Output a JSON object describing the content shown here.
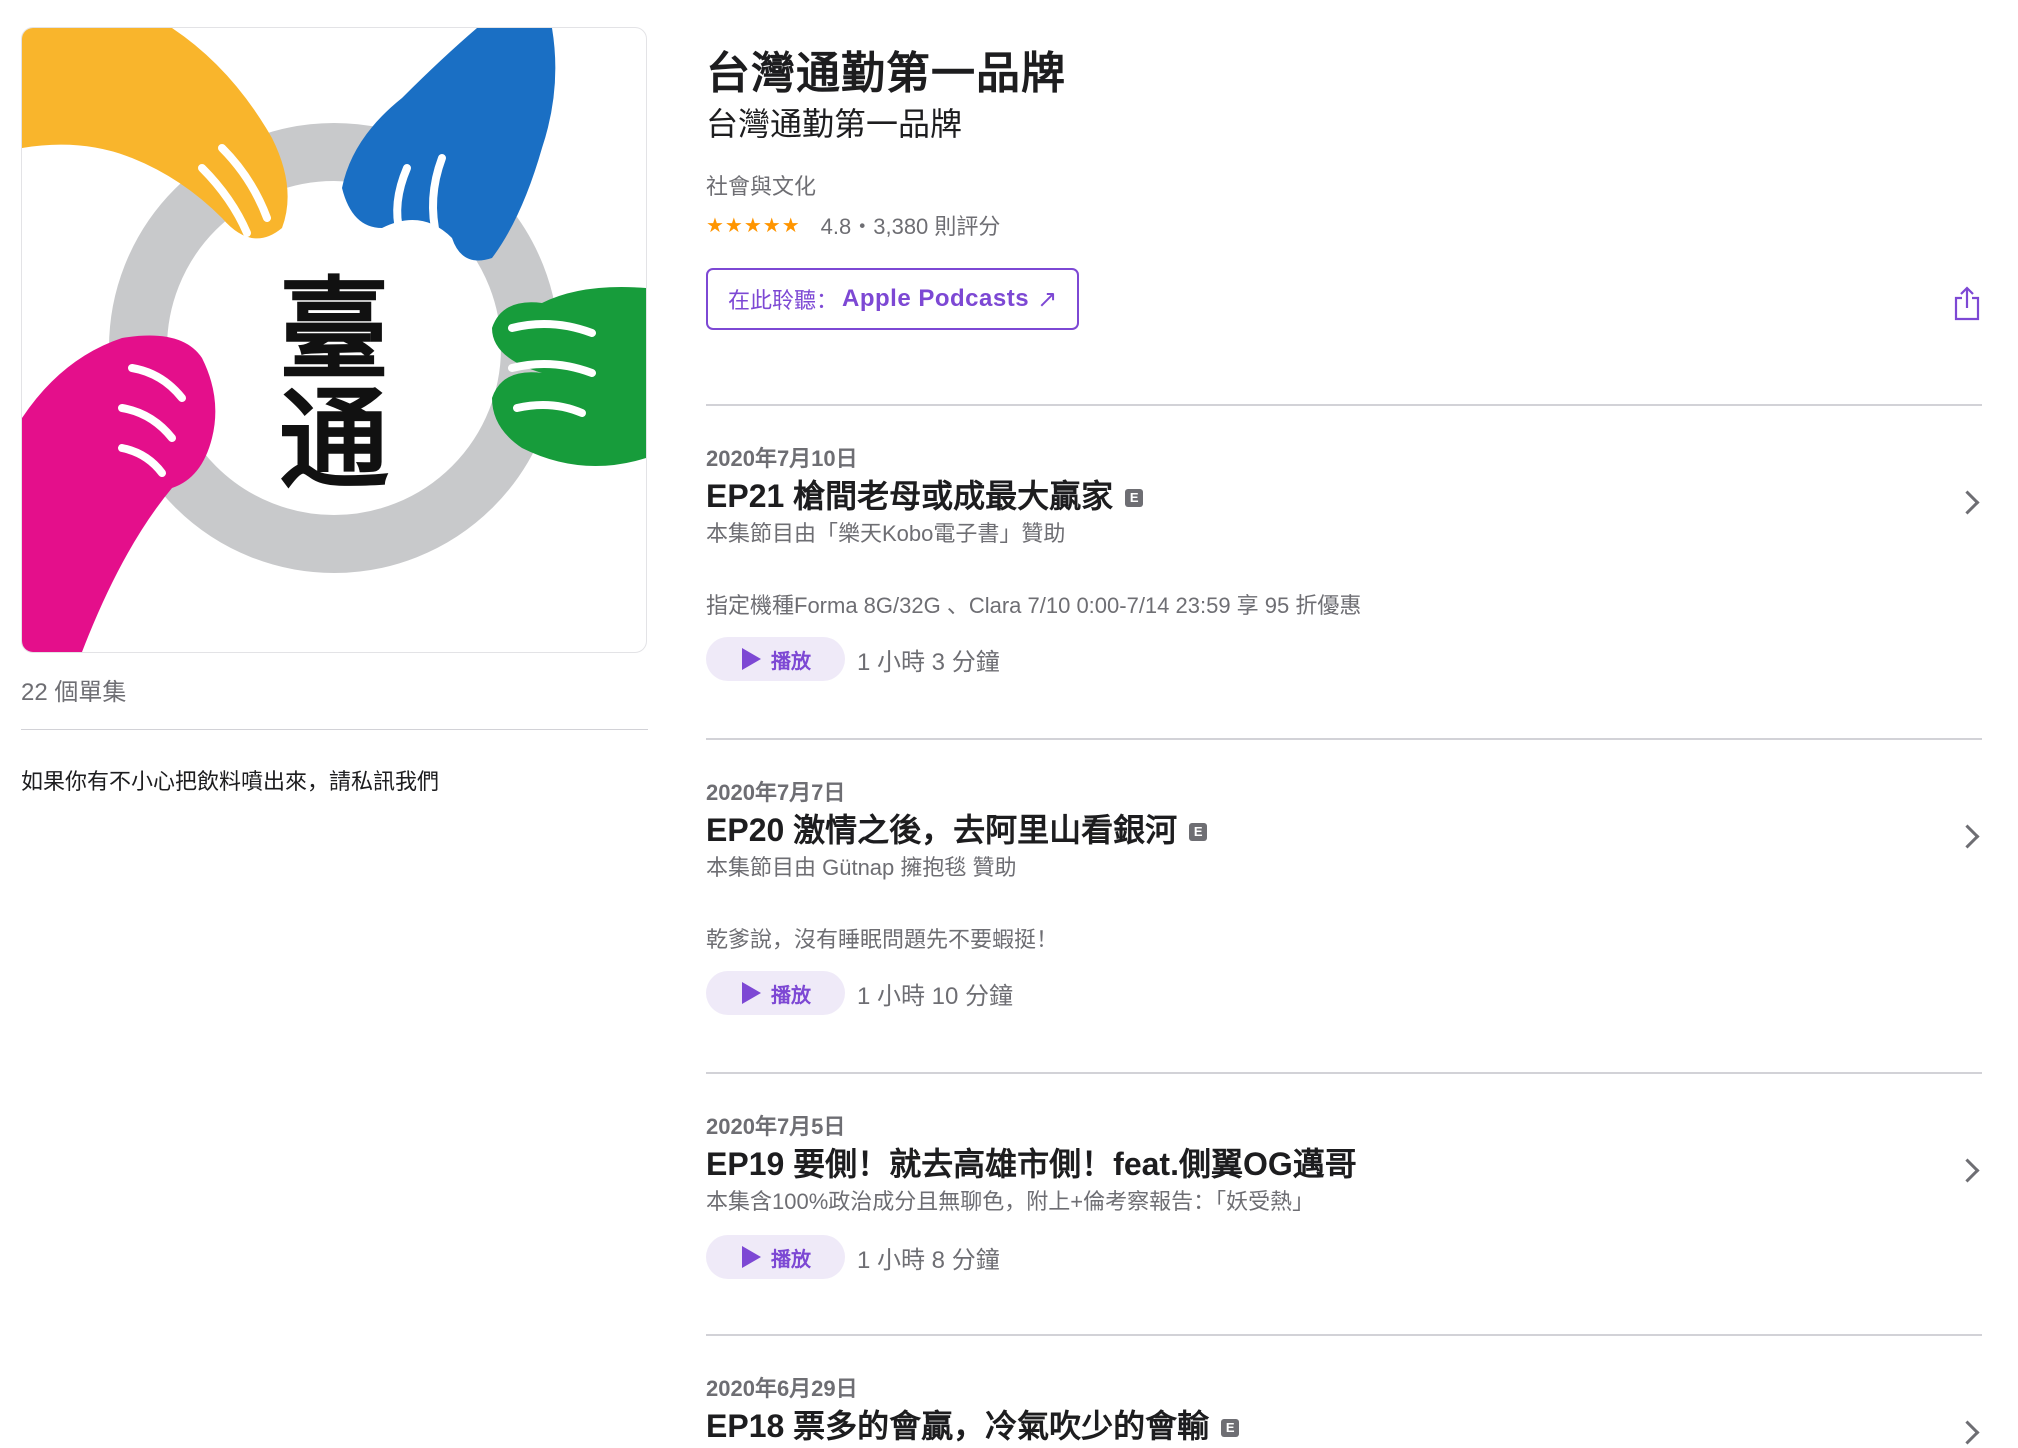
{
  "show": {
    "title": "台灣通勤第一品牌",
    "author": "台灣通勤第一品牌",
    "category": "社會與文化",
    "stars": "★★★★★",
    "rating": "4.8・3,380 則評分",
    "listen_prefix": "在此聆聽：",
    "listen_brand": "Apple Podcasts",
    "listen_arrow": "↗",
    "artwork_text_top": "臺",
    "artwork_text_bottom": "通",
    "episode_count": "22 個單集",
    "description": "如果你有不小心把飲料噴出來，請私訊我們"
  },
  "colors": {
    "accent": "#7d48d4",
    "star": "#ff9500",
    "hand_yellow": "#f9b52c",
    "hand_blue": "#1a6fc4",
    "hand_green": "#179c3b",
    "hand_pink": "#e40f8b",
    "ring_gray": "#c8c9cb"
  },
  "episodes": [
    {
      "date": "2020年7月10日",
      "title": "EP21 槍間老母或成最大贏家",
      "explicit": "E",
      "subtitle": "本集節目由「樂天Kobo電子書」贊助",
      "extra": "指定機種Forma 8G/32G 、Clara 7/10 0:00-7/14 23:59  享 95 折優惠",
      "play": "播放",
      "duration": "1 小時 3 分鐘"
    },
    {
      "date": "2020年7月7日",
      "title": "EP20 激情之後，去阿里山看銀河",
      "explicit": "E",
      "subtitle": "本集節目由 Gütnap 擁抱毯 贊助",
      "extra": "乾爹說，沒有睡眠問題先不要蝦挺！",
      "play": "播放",
      "duration": "1 小時 10 分鐘"
    },
    {
      "date": "2020年7月5日",
      "title": "EP19 要側！就去高雄市側！feat.側翼OG邁哥",
      "subtitle": "本集含100%政治成分且無聊色，附上+倫考察報告：「妖受熱」",
      "play": "播放",
      "duration": "1 小時 8 分鐘"
    },
    {
      "date": "2020年6月29日",
      "title": "EP18 票多的會贏，冷氣吹少的會輸",
      "explicit": "E"
    }
  ]
}
